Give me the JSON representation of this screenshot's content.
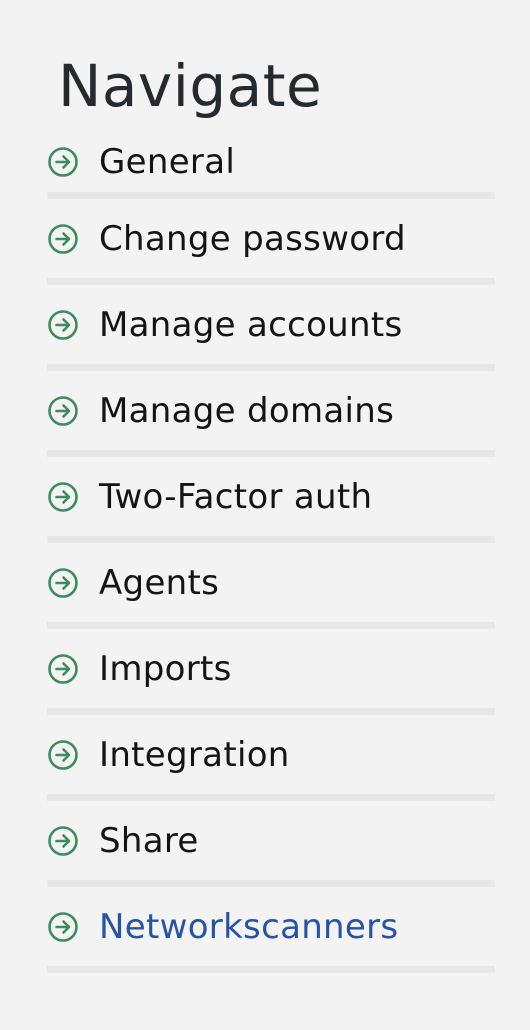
{
  "heading": "Navigate",
  "accent_color": "#3f8a5e",
  "active_color": "#2553a6",
  "items": [
    {
      "label": "General",
      "icon": "arrow-right-circle-icon",
      "active": false
    },
    {
      "label": "Change password",
      "icon": "arrow-right-circle-icon",
      "active": false
    },
    {
      "label": "Manage accounts",
      "icon": "arrow-right-circle-icon",
      "active": false
    },
    {
      "label": "Manage domains",
      "icon": "arrow-right-circle-icon",
      "active": false
    },
    {
      "label": "Two-Factor auth",
      "icon": "arrow-right-circle-icon",
      "active": false
    },
    {
      "label": "Agents",
      "icon": "arrow-right-circle-icon",
      "active": false
    },
    {
      "label": "Imports",
      "icon": "arrow-right-circle-icon",
      "active": false
    },
    {
      "label": "Integration",
      "icon": "arrow-right-circle-icon",
      "active": false
    },
    {
      "label": "Share",
      "icon": "arrow-right-circle-icon",
      "active": false
    },
    {
      "label": "Networkscanners",
      "icon": "arrow-right-circle-icon",
      "active": true
    }
  ]
}
